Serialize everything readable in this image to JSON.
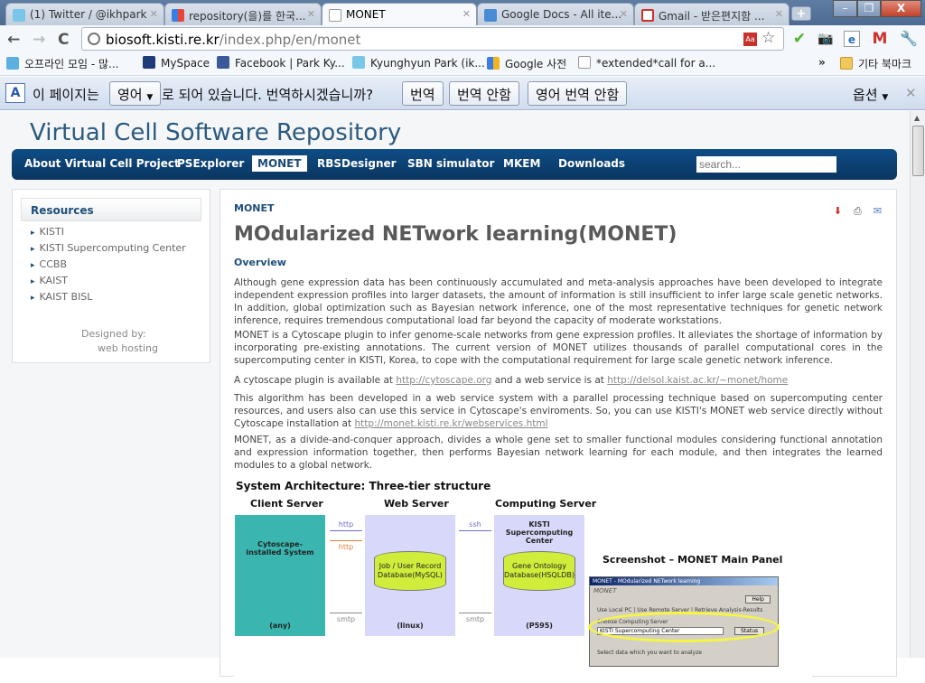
{
  "browser": {
    "tabs": [
      {
        "label": "(1) Twitter / @ikhpark",
        "icon": "twitter-icon",
        "active": false
      },
      {
        "label": "repository(을)를 한국...",
        "icon": "google-icon",
        "active": false
      },
      {
        "label": "MONET",
        "icon": "page-icon",
        "active": true
      },
      {
        "label": "Google Docs - All ite...",
        "icon": "google-docs-icon",
        "active": false
      },
      {
        "label": "Gmail - 받은편지함 ...",
        "icon": "gmail-icon",
        "active": false
      }
    ],
    "new_tab": "+",
    "window_controls": {
      "minimize": "–",
      "maximize": "❐",
      "close": "X"
    },
    "nav": {
      "back": "←",
      "forward": "→",
      "reload": "C"
    },
    "url": {
      "host": "biosoft.kisti.re.kr",
      "path": "/index.php/en/monet"
    },
    "toolbar_icons": [
      "dictionary-icon",
      "star-icon",
      "check-icon",
      "camera-icon",
      "ie-icon",
      "gmail-icon",
      "wrench-icon"
    ],
    "bookmarks": [
      {
        "label": "오프라인 모임 - 많...",
        "icon": "tistory-icon"
      },
      {
        "label": "MySpace",
        "icon": "myspace-icon"
      },
      {
        "label": "Facebook | Park Ky...",
        "icon": "facebook-icon"
      },
      {
        "label": "Kyunghyun Park (ik...",
        "icon": "twitter-icon"
      },
      {
        "label": "Google 사전",
        "icon": "google-icon"
      },
      {
        "label": "*extended*call for a...",
        "icon": "page-icon"
      }
    ],
    "bookmarks_overflow": "»",
    "other_bookmarks": "기타 북마크",
    "translate_bar": {
      "text_before": "이 페이지는",
      "language": "영어",
      "text_after": "로 되어 있습니다. 번역하시겠습니까?",
      "translate": "번역",
      "no_translate": "번역 안함",
      "never_translate": "영어 번역 안함",
      "options": "옵션",
      "close": "✕"
    }
  },
  "site": {
    "title": "Virtual Cell Software Repository",
    "nav": [
      "About Virtual Cell Project",
      "PSExplorer",
      "MONET",
      "RBSDesigner",
      "SBN simulator",
      "MKEM",
      "Downloads"
    ],
    "active_nav": "MONET",
    "search_placeholder": "search..."
  },
  "sidebar": {
    "heading": "Resources",
    "items": [
      "KISTI",
      "KISTI Supercomputing Center",
      "CCBB",
      "KAIST",
      "KAIST BISL"
    ],
    "designed_by": "Designed by:",
    "web_hosting": "web hosting"
  },
  "article": {
    "breadcrumb": "MONET",
    "title": "MOdularized NETwork learning(MONET)",
    "section": "Overview",
    "p1": "Although gene expression data has been continuously accumulated and meta-analysis approaches have been developed to integrate independent expression profiles into larger datasets, the amount of information is still insufficient to infer large scale genetic networks. In addition, global optimization such as Bayesian network inference, one of the most representative techniques for genetic network inference, requires tremendous computational load far beyond the capacity of moderate workstations.",
    "p2": "MONET is a Cytoscape plugin to infer genome-scale networks from gene expression profiles. It alleviates the shortage of information by incorporating pre-existing annotations. The current version of MONET utilizes thousands of parallel computational cores in the supercomputing center in KISTI, Korea, to cope with the computational requirement for large scale genetic network inference.",
    "p3_a": "A cytoscape plugin is available at ",
    "p3_link1": "http://cytoscape.org",
    "p3_b": " and a web service is at ",
    "p3_link2": "http://delsol.kaist.ac.kr/~monet/home",
    "p4": "This algorithm has been developed in a web service system with a parallel processing technique based on supercomputing center resources, and users also can use this service in Cytoscape's enviroments.  So, you can use KISTI's MONET web service directly without Cytoscape installation at ",
    "p4_link": "http://monet.kisti.re.kr/webservices.html",
    "p5": "MONET, as a divide-and-conquer approach, divides a whole gene set to smaller functional modules considering functional annotation and expression information together, then performs Bayesian network learning for each module, and then integrates the learned modules to a global network.",
    "actions": [
      "pdf-icon",
      "print-icon",
      "email-icon"
    ]
  },
  "figure": {
    "title": "System Architecture: Three-tier structure",
    "client": {
      "heading": "Client Server",
      "label": "Cytoscape-installed System",
      "os": "(any)"
    },
    "web": {
      "heading": "Web Server",
      "db": "Job / User Record Database(MySQL)",
      "os": "(linux)"
    },
    "compute": {
      "heading": "Computing Server",
      "label": "KISTI Supercomputing Center",
      "db": "Gene Ontology Database(HSQLDB)",
      "os": "(P595)"
    },
    "arrows": {
      "http_out": "http",
      "http_in": "http",
      "ssh": "ssh",
      "smtp1": "smtp",
      "smtp2": "smtp"
    },
    "screenshot_title": "Screenshot – MONET Main Panel",
    "screenshot": {
      "window_title": "MONET - MOdularized NETwork learning",
      "group": "MONET",
      "help": "Help",
      "tabs": [
        "Use Local PC",
        "Use Remote Server",
        "Retrieve Analysis-Results"
      ],
      "choose_label": "Choose Computing Server",
      "server": "KISTI Supercomputing Center",
      "status": "Status",
      "select_label": "Select data which you want to analyze"
    }
  }
}
